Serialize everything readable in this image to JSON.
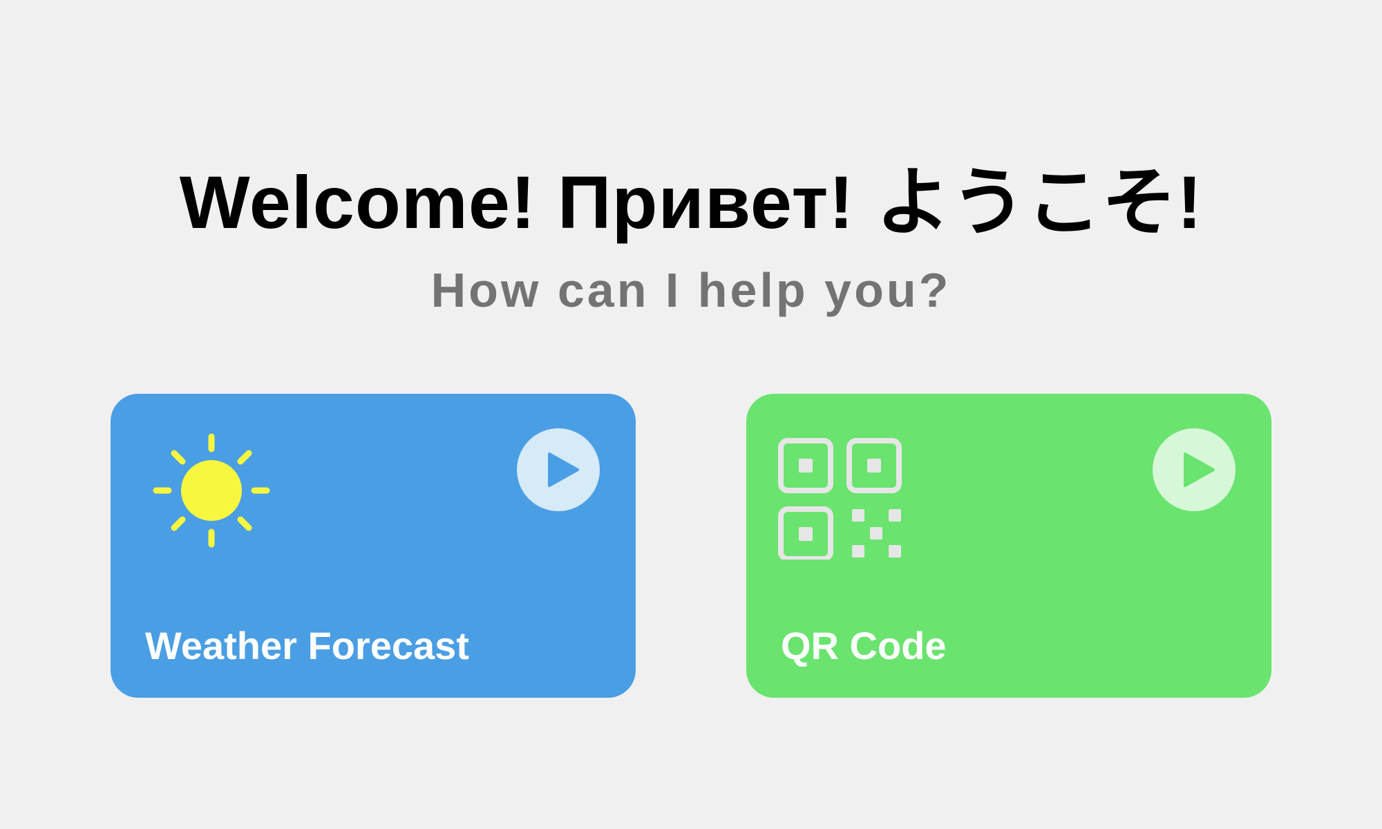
{
  "header": {
    "title": "Welcome! Привет! ようこそ!",
    "subtitle": "How can I help you?"
  },
  "cards": [
    {
      "label": "Weather Forecast",
      "icon": "sun-icon",
      "action_icon": "play-icon",
      "color": "#4a9ee4",
      "icon_color": "#f7f740",
      "action_bg": "#d6eaf8"
    },
    {
      "label": "QR Code",
      "icon": "qr-code-icon",
      "action_icon": "play-icon",
      "color": "#6ae36f",
      "icon_color": "#e6e6e6",
      "action_bg": "#d6f7d8"
    }
  ]
}
